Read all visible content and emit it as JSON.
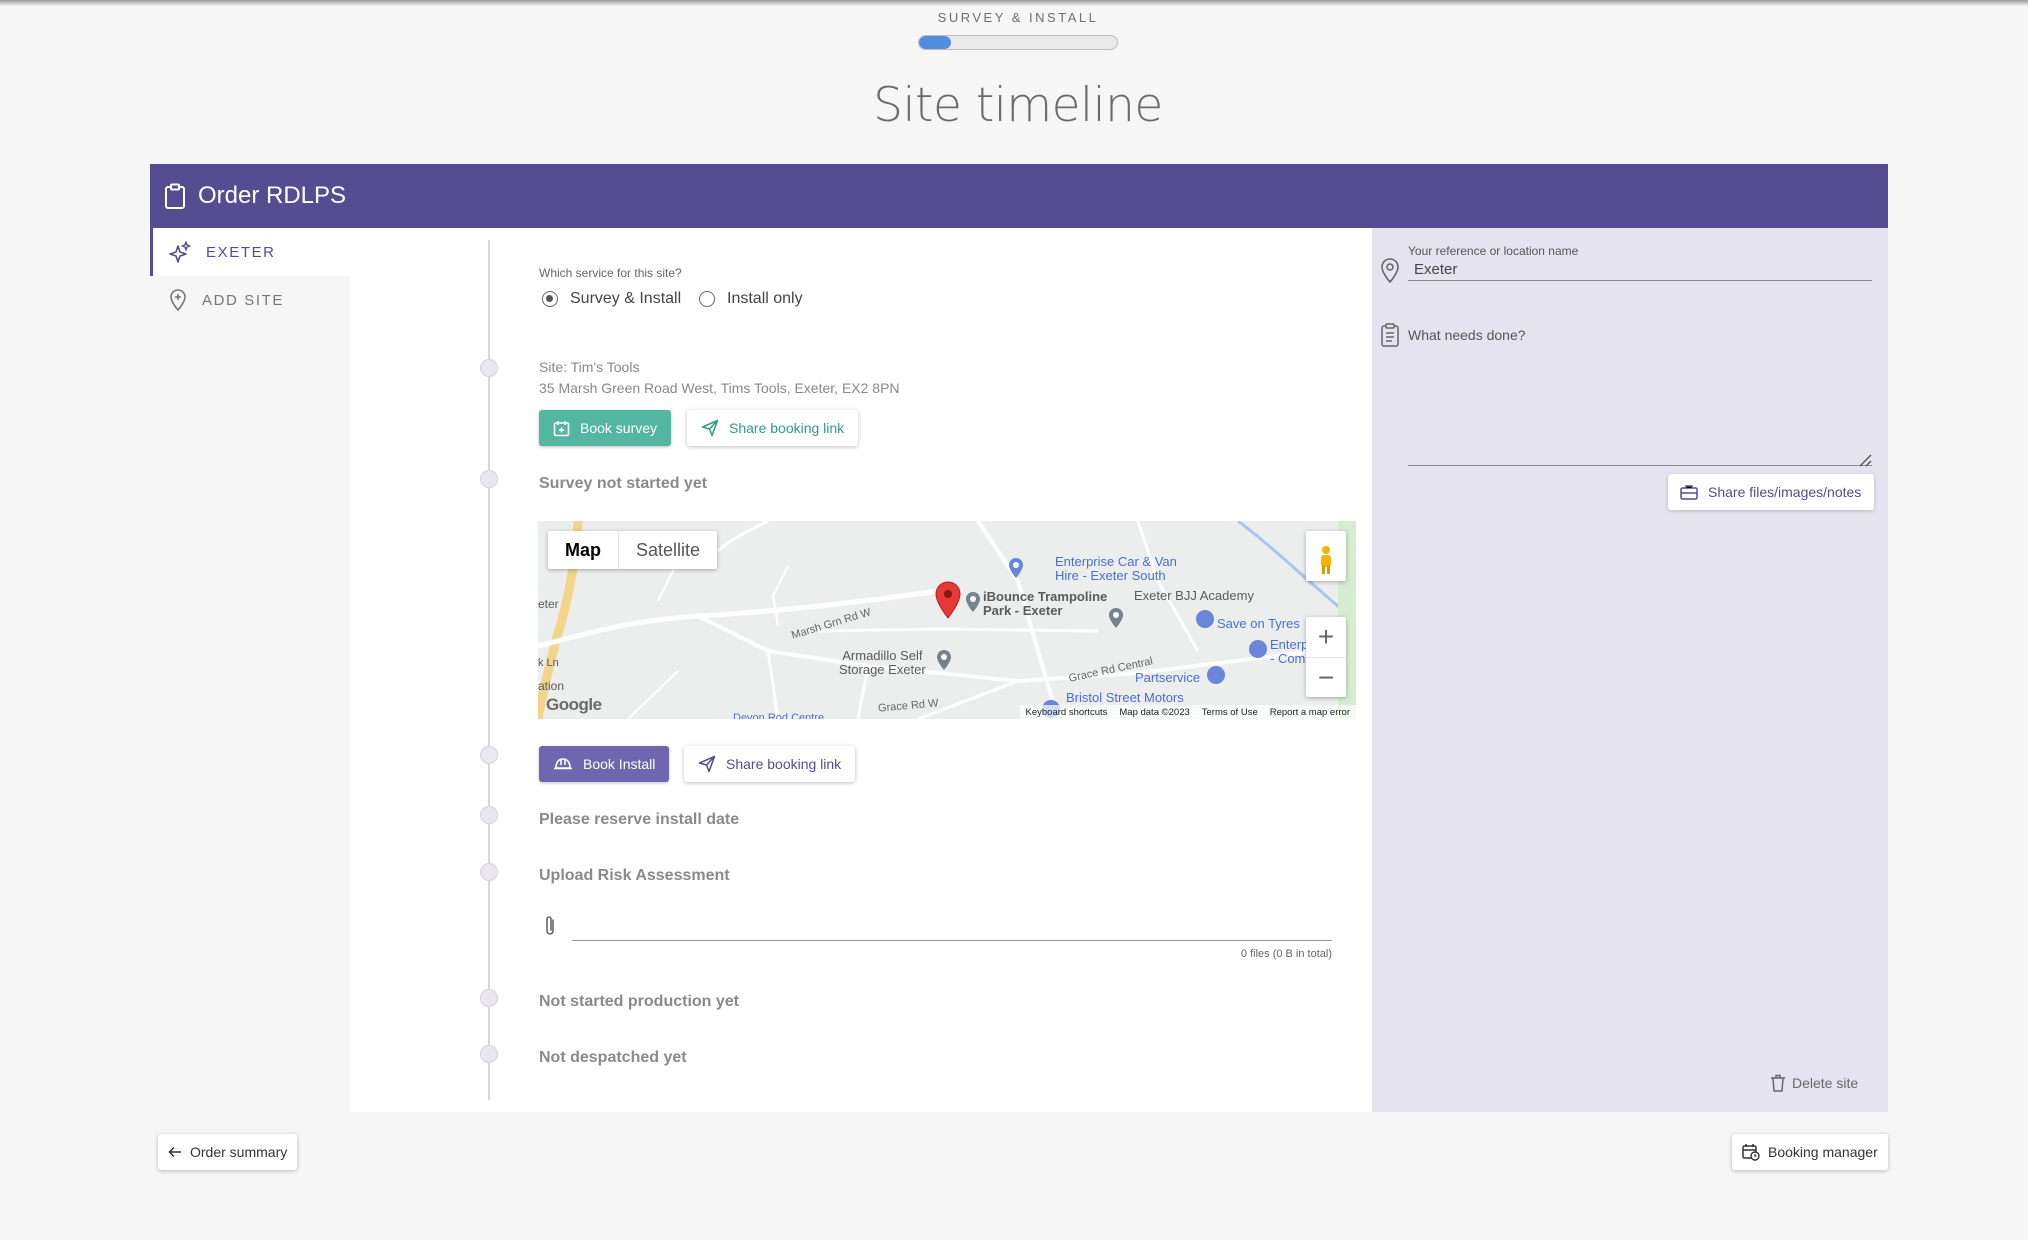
{
  "header": {
    "step_label": "SURVEY & INSTALL",
    "progress_fraction": 0.16,
    "page_title": "Site timeline"
  },
  "order": {
    "title": "Order RDLPS"
  },
  "sidebar": {
    "items": [
      {
        "label": "EXETER",
        "icon": "sparkle-icon",
        "active": true
      },
      {
        "label": "ADD SITE",
        "icon": "add-location-icon",
        "active": false
      }
    ]
  },
  "service": {
    "question": "Which service for this site?",
    "options": [
      {
        "label": "Survey & Install",
        "selected": true
      },
      {
        "label": "Install only",
        "selected": false
      }
    ]
  },
  "site": {
    "name": "Site: Tim's Tools",
    "address": "35 Marsh Green Road West, Tims Tools, Exeter, EX2 8PN"
  },
  "survey": {
    "book_label": "Book survey",
    "share_label": "Share booking link",
    "status": "Survey not started yet"
  },
  "map": {
    "tab_map": "Map",
    "tab_satellite": "Satellite",
    "labels": {
      "enterprise": "Enterprise Car & Van Hire - Exeter South",
      "enterprise_line1": "Enterprise Car & Van",
      "enterprise_line2": "Hire - Exeter South",
      "ibounce_line1": "iBounce Trampoline",
      "ibounce_line2": "Park - Exeter",
      "bjj": "Exeter BJJ Academy",
      "saveontyres": "Save on Tyres",
      "enterprise_com1": "Enterpr",
      "enterprise_com2": "- Com",
      "armadillo_line1": "Armadillo Self",
      "armadillo_line2": "Storage Exeter",
      "partservice": "Partservice",
      "bristol": "Bristol Street Motors",
      "marsh_road": "Marsh Grn Rd W",
      "grace_central": "Grace Rd Central",
      "grace_w": "Grace Rd W",
      "devon_road": "Devon Rod Centre",
      "exeter_fragment": "eter",
      "ln_fragment": "k Ln",
      "ation_fragment": "ation",
      "google": "Google",
      "footer_shortcuts": "Keyboard shortcuts",
      "footer_data": "Map data ©2023",
      "footer_terms": "Terms of Use",
      "footer_report": "Report a map error"
    }
  },
  "install": {
    "book_label": "Book Install",
    "share_label": "Share booking link",
    "status": "Please reserve install date"
  },
  "risk": {
    "title": "Upload Risk Assessment",
    "files_summary": "0 files (0 B in total)"
  },
  "production": {
    "status": "Not started production yet"
  },
  "despatch": {
    "status": "Not despatched yet"
  },
  "details": {
    "reference_label": "Your reference or location name",
    "reference_value": "Exeter",
    "needs_label": "What needs done?",
    "needs_value": "",
    "share_files_label": "Share files/images/notes",
    "delete_label": "Delete site"
  },
  "footer": {
    "back_label": "Order summary",
    "manager_label": "Booking manager"
  },
  "colors": {
    "brand_purple": "#554c91",
    "teal": "#52b6a0",
    "panel_lavender": "#e6e3f0"
  }
}
